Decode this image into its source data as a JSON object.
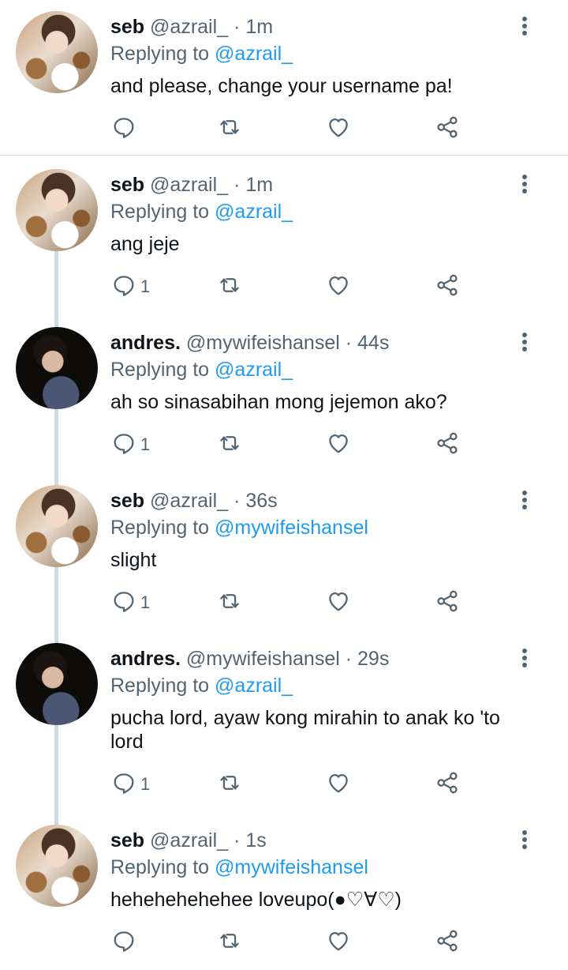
{
  "tweets": [
    {
      "name": "seb",
      "handle": "@azrail_",
      "time": "1m",
      "reply_label": "Replying to",
      "reply_to": "@azrail_",
      "text": "and please, change your username pa!",
      "reply_count": "",
      "avatar": "seb"
    },
    {
      "name": "seb",
      "handle": "@azrail_",
      "time": "1m",
      "reply_label": "Replying to",
      "reply_to": "@azrail_",
      "text": "ang jeje",
      "reply_count": "1",
      "avatar": "seb"
    },
    {
      "name": "andres.",
      "handle": "@mywifeishansel",
      "time": "44s",
      "reply_label": "Replying to",
      "reply_to": "@azrail_",
      "text": "ah so sinasabihan mong jejemon ako?",
      "reply_count": "1",
      "avatar": "andres"
    },
    {
      "name": "seb",
      "handle": "@azrail_",
      "time": "36s",
      "reply_label": "Replying to",
      "reply_to": "@mywifeishansel",
      "text": "slight",
      "reply_count": "1",
      "avatar": "seb"
    },
    {
      "name": "andres.",
      "handle": "@mywifeishansel",
      "time": "29s",
      "reply_label": "Replying to",
      "reply_to": "@azrail_",
      "text": "pucha lord, ayaw kong mirahin to anak ko 'to lord",
      "reply_count": "1",
      "avatar": "andres"
    },
    {
      "name": "seb",
      "handle": "@azrail_",
      "time": "1s",
      "reply_label": "Replying to",
      "reply_to": "@mywifeishansel",
      "text": "hehehehehehee loveupo(●♡∀♡)",
      "reply_count": "",
      "avatar": "seb"
    }
  ],
  "separator": "·",
  "icons": {
    "reply": "reply-icon",
    "retweet": "retweet-icon",
    "like": "heart-icon",
    "share": "share-icon",
    "more": "more-vertical-icon"
  },
  "colors": {
    "text": "#0f1419",
    "muted": "#536471",
    "link": "#1d9bf0",
    "line": "#cfd9de"
  }
}
